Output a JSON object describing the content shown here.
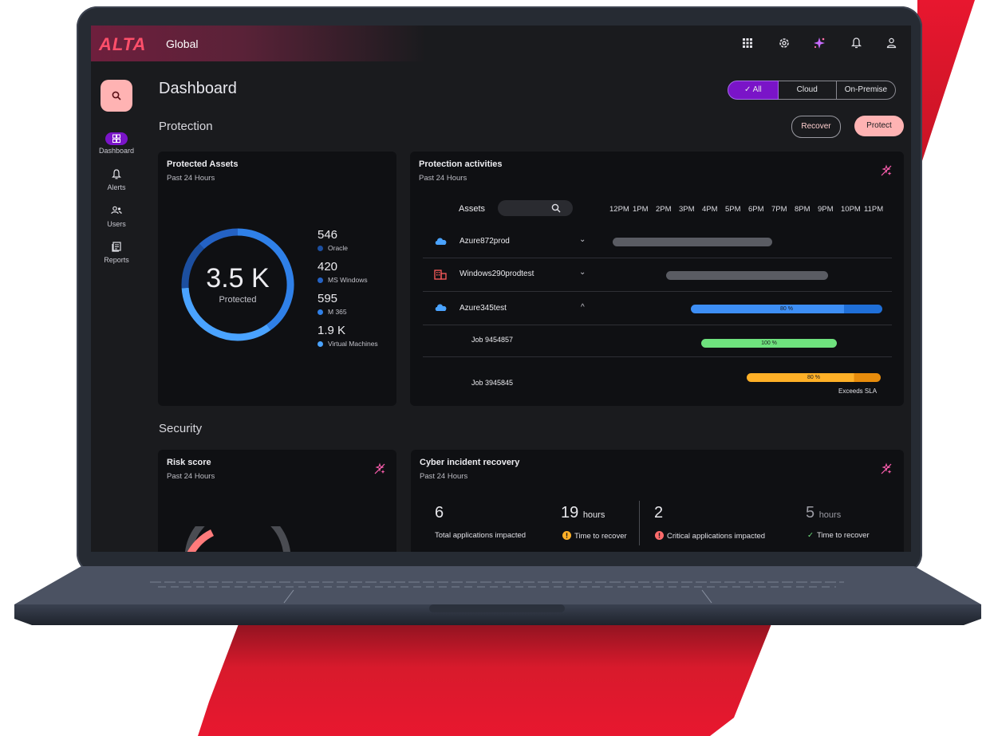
{
  "app": {
    "logo": "ALTA",
    "scope": "Global"
  },
  "topbar_icons": [
    "apps-grid-icon",
    "settings-gear-icon",
    "ai-sparkle-icon",
    "notifications-bell-icon",
    "user-profile-icon"
  ],
  "nav": {
    "items": [
      {
        "label": "Dashboard",
        "icon": "dashboard-grid-icon",
        "active": true
      },
      {
        "label": "Alerts",
        "icon": "bell-icon",
        "active": false
      },
      {
        "label": "Users",
        "icon": "users-icon",
        "active": false
      },
      {
        "label": "Reports",
        "icon": "reports-icon",
        "active": false
      }
    ]
  },
  "page_title": "Dashboard",
  "filter": {
    "options": [
      "All",
      "Cloud",
      "On-Premise"
    ],
    "selected": "All"
  },
  "protection": {
    "heading": "Protection",
    "recover_label": "Recover",
    "protect_label": "Protect",
    "assets_card": {
      "title": "Protected Assets",
      "subtitle": "Past 24 Hours",
      "total": "3.5 K",
      "total_label": "Protected",
      "legend": [
        {
          "value": "546",
          "label": "Oracle",
          "color": "#1c4fa0"
        },
        {
          "value": "420",
          "label": "MS Windows",
          "color": "#2462c4"
        },
        {
          "value": "595",
          "label": "M 365",
          "color": "#2f80e8"
        },
        {
          "value": "1.9 K",
          "label": "Virtual Machines",
          "color": "#4aa3ff"
        }
      ]
    },
    "activities_card": {
      "title": "Protection activities",
      "subtitle": "Past 24 Hours",
      "assets_label": "Assets",
      "hours": [
        "12PM",
        "1PM",
        "2PM",
        "3PM",
        "4PM",
        "5PM",
        "6PM",
        "7PM",
        "8PM",
        "9PM",
        "10PM",
        "11PM"
      ],
      "rows": [
        {
          "name": "Azure872prod",
          "icon": "cloud-icon",
          "expanded": false,
          "bar_label": ""
        },
        {
          "name": "Windows290prodtest",
          "icon": "building-icon",
          "expanded": false,
          "bar_label": ""
        },
        {
          "name": "Azure345test",
          "icon": "cloud-icon",
          "expanded": true,
          "bar_label": "80 %",
          "progress": 0.8
        }
      ],
      "jobs": [
        {
          "name": "Job 9454857",
          "bar_label": "100 %",
          "progress": 1.0,
          "status": ""
        },
        {
          "name": "Job 3945845",
          "bar_label": "80 %",
          "progress": 0.8,
          "status": "Exceeds SLA"
        }
      ]
    }
  },
  "security": {
    "heading": "Security",
    "risk_card": {
      "title": "Risk score",
      "subtitle": "Past 24 Hours"
    },
    "cyber_card": {
      "title": "Cyber incident recovery",
      "subtitle": "Past 24 Hours",
      "left": [
        {
          "value": "6",
          "unit": "",
          "label": "Total applications impacted"
        },
        {
          "value": "19",
          "unit": "hours",
          "label": "Time to recover",
          "status": "warning"
        }
      ],
      "right": [
        {
          "value": "2",
          "unit": "",
          "label": "Critical applications impacted",
          "status": "error"
        },
        {
          "value": "5",
          "unit": "hours",
          "label": "Time to recover",
          "status": "ok"
        }
      ]
    }
  },
  "colors": {
    "accent": "#7a14c8",
    "pink": "#ffb3b3",
    "brand_red": "#e8172f"
  }
}
